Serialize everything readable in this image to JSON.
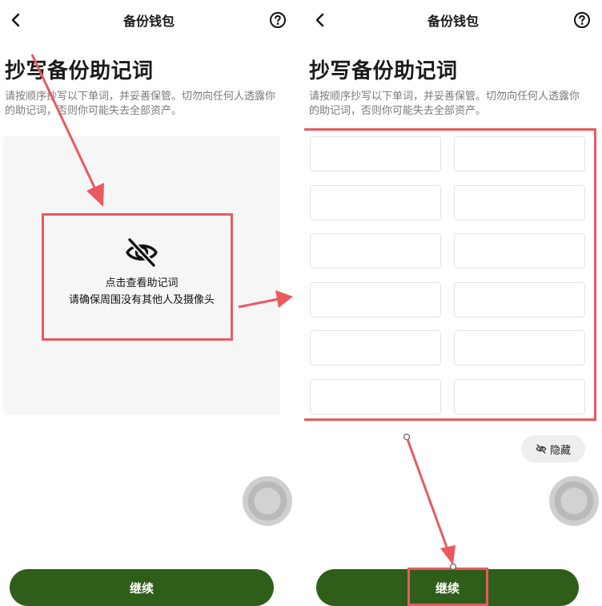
{
  "left_screen": {
    "title": "备份钱包",
    "heading": "抄写备份助记词",
    "description": "请按顺序抄写以下单词，并妥善保管。切勿向任何人透露你的助记词，否则你可能失去全部资产。",
    "reveal_line1": "点击查看助记词",
    "reveal_line2": "请确保周围没有其他人及摄像头",
    "continue_label": "继续"
  },
  "right_screen": {
    "title": "备份钱包",
    "heading": "抄写备份助记词",
    "description": "请按顺序抄写以下单词，并妥善保管。切勿向任何人透露你的助记词，否则你可能失去全部资产。",
    "word_count": 12,
    "hide_label": "隐藏",
    "continue_label": "继续"
  },
  "colors": {
    "primary": "#2f5e1a",
    "annotation": "#e95a5f",
    "description": "#7a7a7a"
  },
  "icons": {
    "back": "chevron-left-icon",
    "help": "help-circle-icon",
    "hidden": "eye-slash-icon"
  }
}
